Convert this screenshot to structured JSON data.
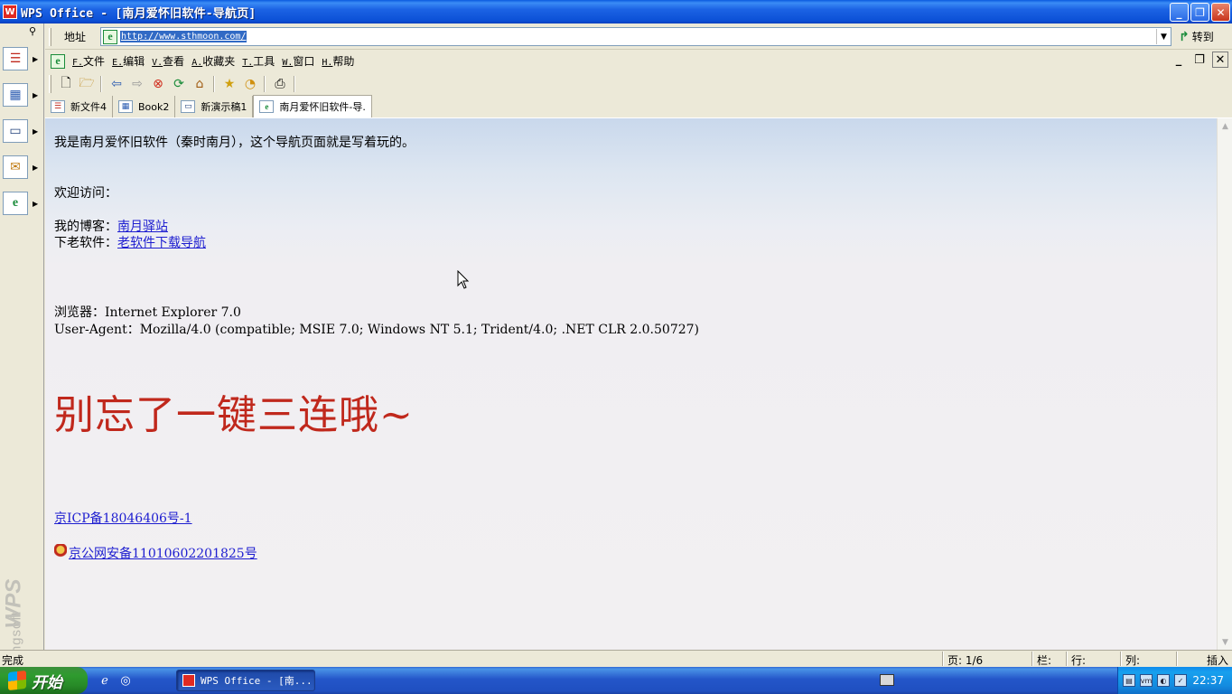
{
  "window": {
    "title": "WPS Office - [南月爱怀旧软件-导航页]",
    "app_icon": "wps-icon",
    "controls": [
      "minimize",
      "restore",
      "close"
    ]
  },
  "address_bar": {
    "label": "地址",
    "url": "http://www.sthmoon.com/",
    "go_label": "转到"
  },
  "menu": {
    "items": [
      {
        "key": "F.",
        "label": "文件"
      },
      {
        "key": "E.",
        "label": "编辑"
      },
      {
        "key": "V.",
        "label": "查看"
      },
      {
        "key": "A.",
        "label": "收藏夹"
      },
      {
        "key": "T.",
        "label": "工具"
      },
      {
        "key": "W.",
        "label": "窗口"
      },
      {
        "key": "H.",
        "label": "帮助"
      }
    ]
  },
  "toolbar": {
    "icons": [
      "new-doc-icon",
      "open-folder-icon",
      "back-icon",
      "forward-icon",
      "stop-icon",
      "refresh-icon",
      "home-icon",
      "favorites-icon",
      "history-icon",
      "print-icon"
    ]
  },
  "tabs": [
    {
      "label": "新文件4",
      "icon": "writer-doc-icon"
    },
    {
      "label": "Book2",
      "icon": "spreadsheet-icon"
    },
    {
      "label": "新演示稿1",
      "icon": "presentation-icon"
    },
    {
      "label": "南月爱怀旧软件-导.",
      "icon": "browser-icon",
      "active": true
    }
  ],
  "content": {
    "intro": "我是南月爱怀旧软件（秦时南月），这个导航页面就是写着玩的。",
    "welcome": "欢迎访问：",
    "blog_label": "我的博客：",
    "blog_link": "南月驿站",
    "soft_label": "下老软件：",
    "soft_link": "老软件下载导航",
    "browser_label": "浏览器：",
    "browser_value": "Internet Explorer 7.0",
    "ua_label": "User-Agent：",
    "ua_value": "Mozilla/4.0 (compatible; MSIE 7.0; Windows NT 5.1; Trident/4.0; .NET CLR 2.0.50727)",
    "big_text": "别忘了一键三连哦~",
    "icp_link": "京ICP备18046406号-1",
    "police_link": "京公网安备11010602201825号"
  },
  "statusbar": {
    "status": "完成",
    "page": "页: 1/6",
    "column_label": "栏:",
    "row_label": "行:",
    "col_label": "列:",
    "insert": "插入"
  },
  "sidebar": {
    "items": [
      "writer-icon",
      "spreadsheet-icon",
      "presentation-icon",
      "mail-icon",
      "browser-icon"
    ],
    "brand_small": "Kingsoft",
    "brand_big": "WPS"
  },
  "taskbar": {
    "start_label": "开始",
    "task_label": "WPS Office - [南...",
    "clock": "22:37"
  },
  "colors": {
    "link": "#1e1ed0",
    "big_text": "#c0281c",
    "titlebar": "#0b50d6"
  }
}
